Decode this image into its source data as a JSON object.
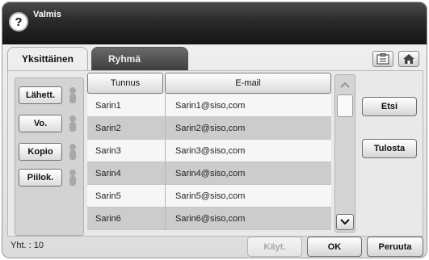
{
  "status": {
    "title": "Valmis"
  },
  "tabs": [
    {
      "label": "Yksittäinen",
      "active": true
    },
    {
      "label": "Ryhmä",
      "active": false
    }
  ],
  "toolbar_icons": [
    "address-book-icon",
    "home-icon"
  ],
  "filters": [
    {
      "label": "Lähett."
    },
    {
      "label": "Vo."
    },
    {
      "label": "Kopio"
    },
    {
      "label": "Piilok."
    }
  ],
  "table": {
    "headers": [
      "Tunnus",
      "E-mail"
    ],
    "rows": [
      {
        "id": "Sarin1",
        "email": "Sarin1@siso,com"
      },
      {
        "id": "Sarin2",
        "email": "Sarin2@siso,com"
      },
      {
        "id": "Sarin3",
        "email": "Sarin3@siso,com"
      },
      {
        "id": "Sarin4",
        "email": "Sarin4@siso,com"
      },
      {
        "id": "Sarin5",
        "email": "Sarin5@siso,com"
      },
      {
        "id": "Sarin6",
        "email": "Sarin6@siso,com"
      }
    ]
  },
  "actions": {
    "search_label": "Etsi",
    "print_label": "Tulosta"
  },
  "footer": {
    "total": "Yht. : 10",
    "apply_label": "Käyt.",
    "ok_label": "OK",
    "cancel_label": "Peruuta"
  }
}
